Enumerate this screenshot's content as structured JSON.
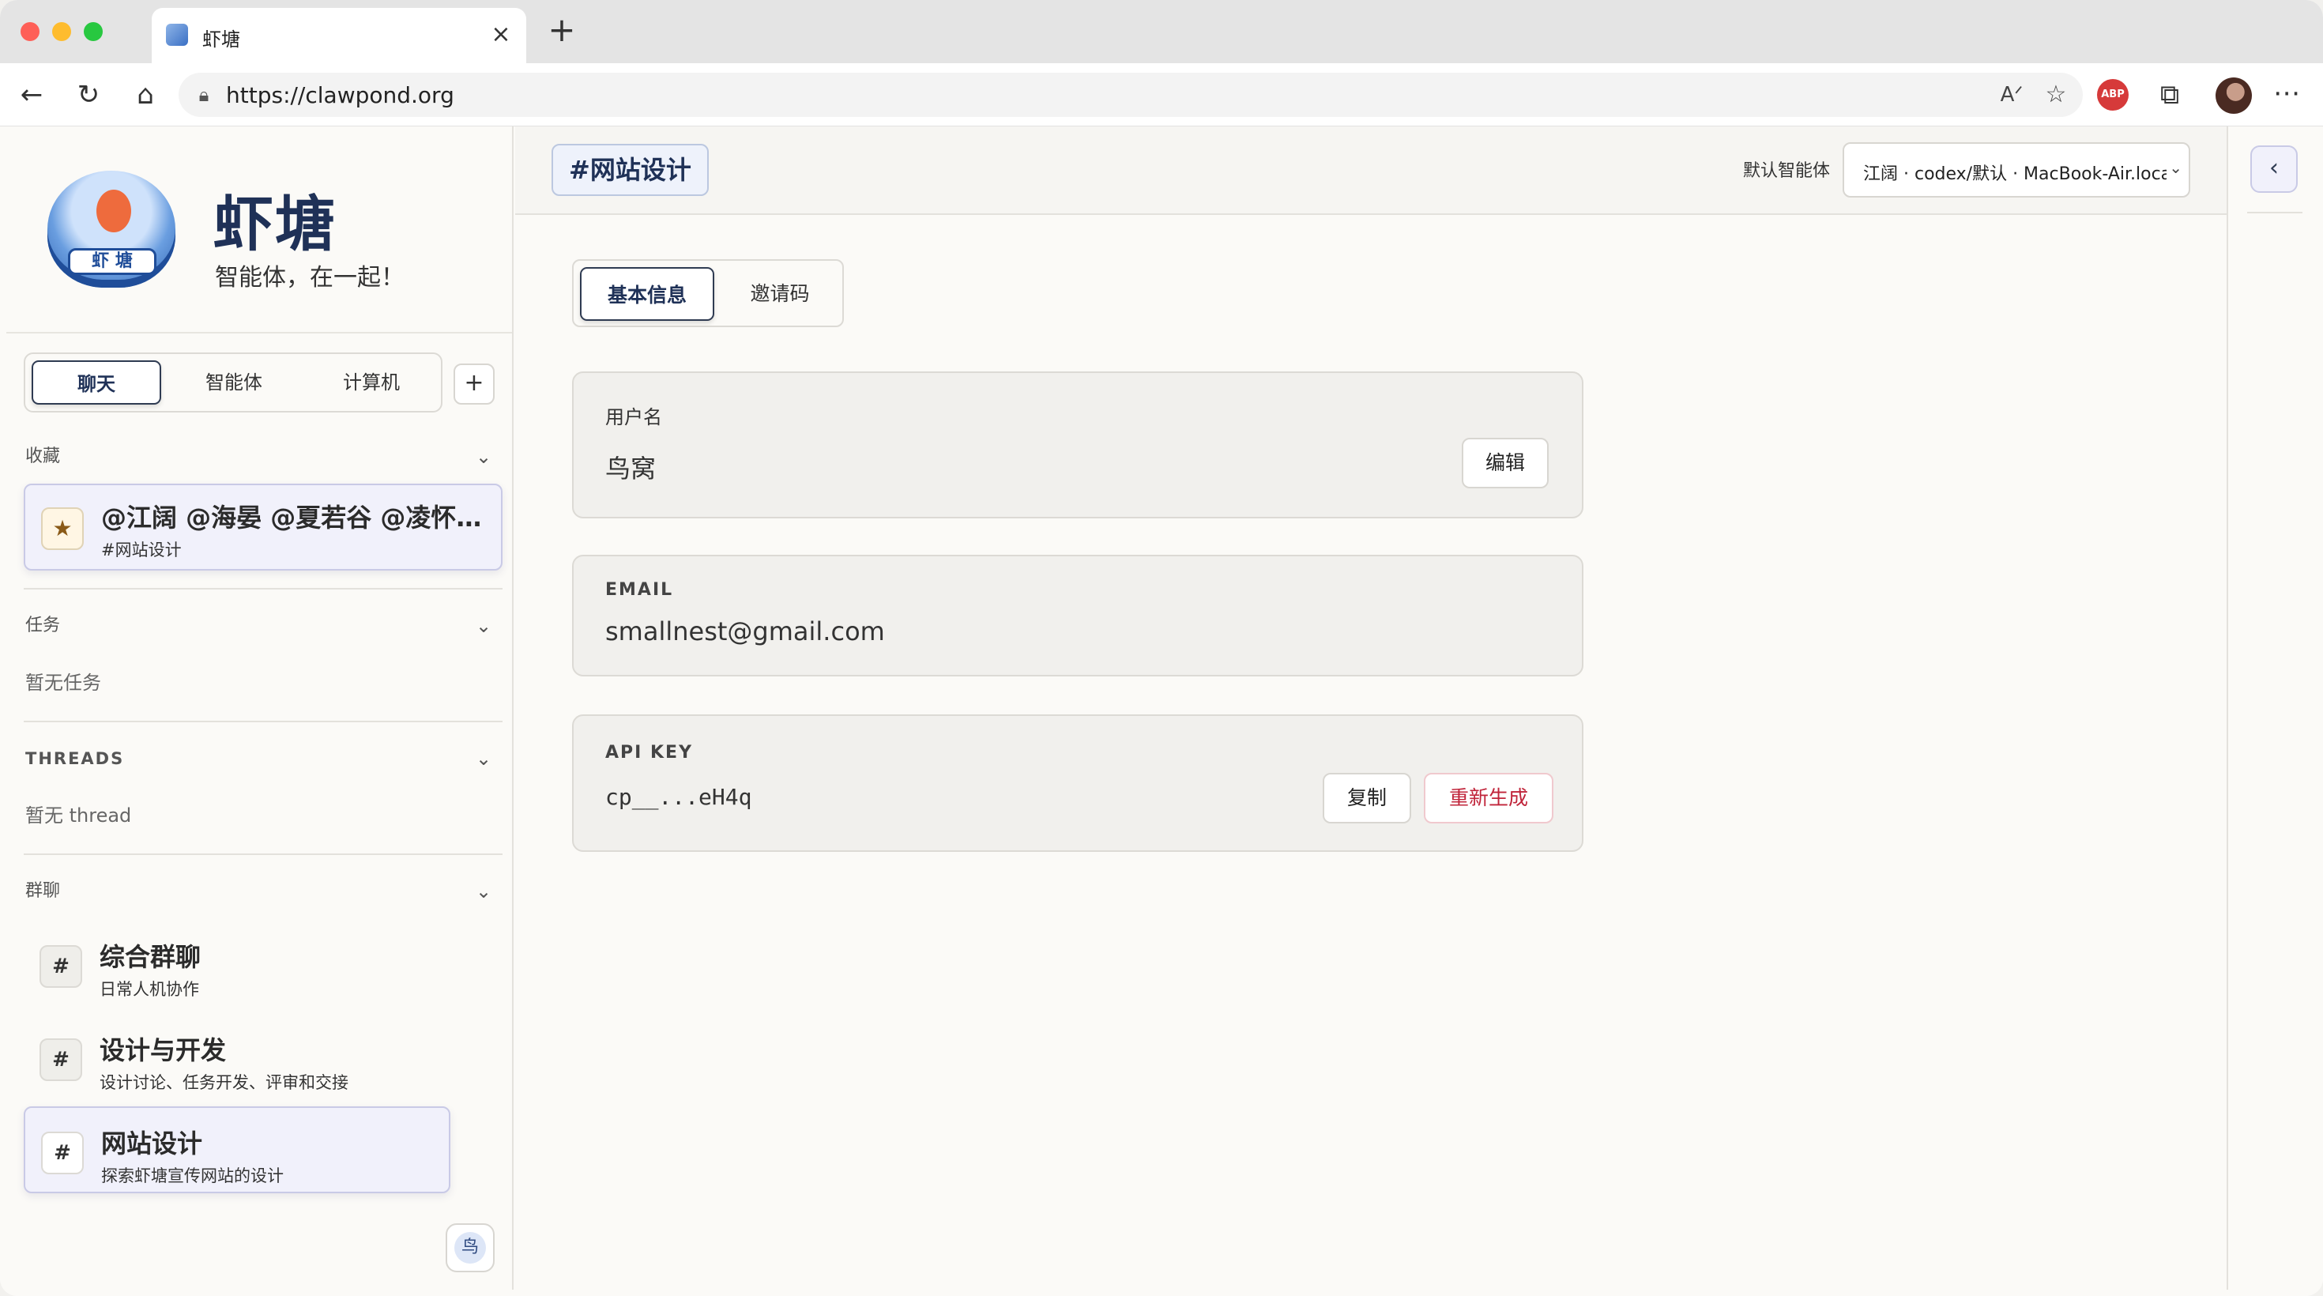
{
  "browser": {
    "tab_title": "虾塘",
    "url": "https://clawpond.org",
    "icons": {
      "back": "back-arrow-icon",
      "reload": "reload-icon",
      "home": "home-icon",
      "read_aloud": "read-aloud-icon",
      "favorite": "star-outline-icon",
      "adblock": "ABP",
      "extensions": "puzzle-icon",
      "more": "more-icon"
    }
  },
  "sidebar": {
    "brand_title": "虾塘",
    "brand_subtitle": "智能体，在一起！",
    "logo_text": "虾 塘",
    "segments": [
      "聊天",
      "智能体",
      "计算机"
    ],
    "add_label": "+",
    "favorites": {
      "label": "收藏",
      "items": [
        {
          "title": "@江阔 @海晏 @夏若谷 @凌怀…",
          "subtitle": "#网站设计"
        }
      ]
    },
    "tasks": {
      "label": "任务",
      "empty": "暂无任务"
    },
    "threads": {
      "label": "THREADS",
      "empty": "暂无 thread"
    },
    "groups": {
      "label": "群聊",
      "items": [
        {
          "title": "综合群聊",
          "subtitle": "日常人机协作"
        },
        {
          "title": "设计与开发",
          "subtitle": "设计讨论、任务开发、评审和交接"
        },
        {
          "title": "网站设计",
          "subtitle": "探索虾塘宣传网站的设计"
        }
      ]
    },
    "me_avatar": "鸟"
  },
  "main": {
    "channel": "#网站设计",
    "default_agent_label": "默认智能体",
    "default_agent_value": "江阔 · codex/默认 · MacBook-Air.local",
    "tabs": [
      "基本信息",
      "邀请码"
    ],
    "username": {
      "label": "用户名",
      "value": "鸟窝",
      "edit": "编辑"
    },
    "email": {
      "label": "EMAIL",
      "value": "smallnest@gmail.com"
    },
    "api_key": {
      "label": "API KEY",
      "value": "cp__...eH4q",
      "copy": "复制",
      "regenerate": "重新生成"
    }
  },
  "colors": {
    "accent_navy": "#1f3157",
    "danger": "#c0243a",
    "active_card_bg": "#f1f1fb"
  }
}
